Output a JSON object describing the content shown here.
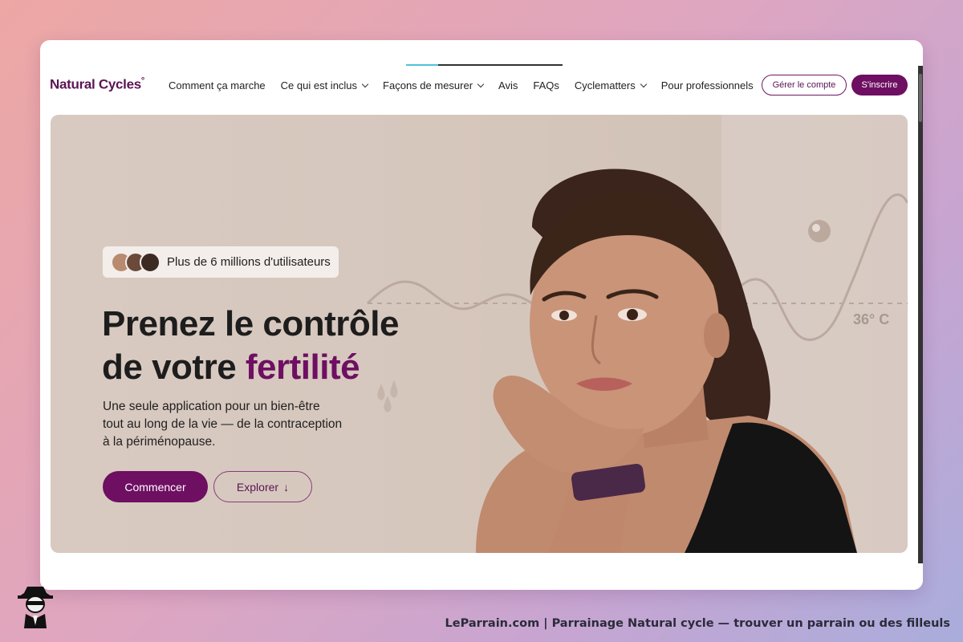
{
  "nav": {
    "logo": "Natural Cycles",
    "logo_mark": "°",
    "items": [
      {
        "label": "Comment ça marche",
        "dropdown": false
      },
      {
        "label": "Ce qui est inclus",
        "dropdown": true
      },
      {
        "label": "Façons de mesurer",
        "dropdown": true
      },
      {
        "label": "Avis",
        "dropdown": false
      },
      {
        "label": "FAQs",
        "dropdown": false
      },
      {
        "label": "Cyclematters",
        "dropdown": true
      },
      {
        "label": "Pour professionnels",
        "dropdown": false
      }
    ],
    "account_button": "Gérer le compte",
    "signup_button": "S'inscrire"
  },
  "hero": {
    "social_proof": "Plus de 6 millions d'utilisateurs",
    "headline_line1": "Prenez le contrôle",
    "headline_line2_prefix": "de votre ",
    "headline_accent": "fertilité",
    "subtitle": "Une seule application pour un bien-être tout au long de la vie — de la contraception à la périménopause.",
    "start_button": "Commencer",
    "explore_button": "Explorer",
    "explore_icon": "arrow-down-icon",
    "temperature_label": "36° C"
  },
  "colors": {
    "brand": "#6e0f62",
    "hero_bg": "#d6c7bd",
    "wave": "#b9a89d"
  },
  "caption": "LeParrain.com | Parrainage Natural cycle — trouver un parrain ou des filleuls"
}
